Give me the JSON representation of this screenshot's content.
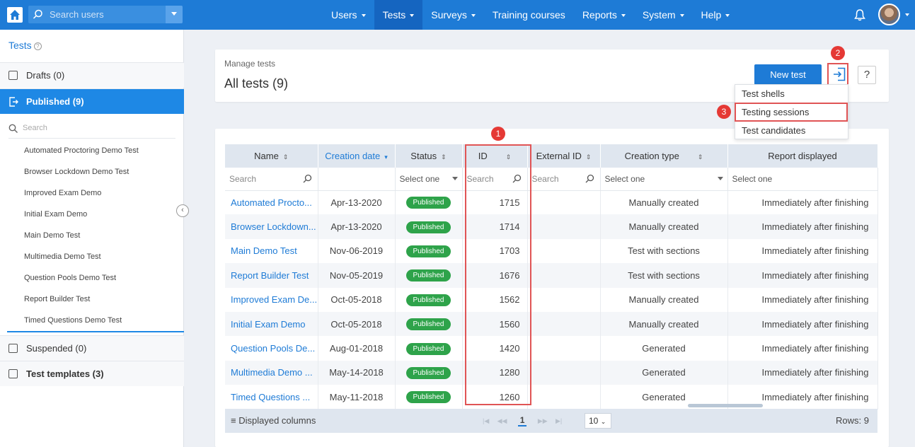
{
  "topbar": {
    "search_placeholder": "Search users",
    "nav": [
      {
        "label": "Users",
        "has_caret": true
      },
      {
        "label": "Tests",
        "has_caret": true,
        "active": true
      },
      {
        "label": "Surveys",
        "has_caret": true
      },
      {
        "label": "Training courses",
        "has_caret": false
      },
      {
        "label": "Reports",
        "has_caret": true
      },
      {
        "label": "System",
        "has_caret": true
      },
      {
        "label": "Help",
        "has_caret": true
      }
    ],
    "icons": [
      "home-icon",
      "search-icon",
      "bell-icon",
      "avatar"
    ]
  },
  "sidebar": {
    "title": "Tests",
    "sections": {
      "drafts": "Drafts (0)",
      "published": "Published (9)",
      "suspended": "Suspended (0)",
      "templates": "Test templates (3)"
    },
    "search_placeholder": "Search",
    "items": [
      "Automated Proctoring Demo Test",
      "Browser Lockdown Demo Test",
      "Improved Exam Demo",
      "Initial Exam Demo",
      "Main Demo Test",
      "Multimedia Demo Test",
      "Question Pools Demo Test",
      "Report Builder Test",
      "Timed Questions Demo Test"
    ]
  },
  "header": {
    "breadcrumb": "Manage tests",
    "title": "All tests (9)",
    "new_button": "New test",
    "help_button": "?"
  },
  "dropdown": {
    "items": [
      "Test shells",
      "Testing sessions",
      "Test candidates"
    ]
  },
  "markers": [
    "1",
    "2",
    "3"
  ],
  "table": {
    "columns": [
      "Name",
      "Creation date",
      "Status",
      "ID",
      "External ID",
      "Creation type",
      "Report displayed"
    ],
    "filters": {
      "name": "Search",
      "status": "Select one",
      "id": "Search",
      "external_id": "Search",
      "creation_type": "Select one",
      "report": "Select one"
    },
    "rows": [
      {
        "name": "Automated Procto...",
        "date": "Apr-13-2020",
        "status": "Published",
        "id": "1715",
        "ext": "",
        "ctype": "Manually created",
        "report": "Immediately after finishing"
      },
      {
        "name": "Browser Lockdown...",
        "date": "Apr-13-2020",
        "status": "Published",
        "id": "1714",
        "ext": "",
        "ctype": "Manually created",
        "report": "Immediately after finishing"
      },
      {
        "name": "Main Demo Test",
        "date": "Nov-06-2019",
        "status": "Published",
        "id": "1703",
        "ext": "",
        "ctype": "Test with sections",
        "report": "Immediately after finishing"
      },
      {
        "name": "Report Builder Test",
        "date": "Nov-05-2019",
        "status": "Published",
        "id": "1676",
        "ext": "",
        "ctype": "Test with sections",
        "report": "Immediately after finishing"
      },
      {
        "name": "Improved Exam De...",
        "date": "Oct-05-2018",
        "status": "Published",
        "id": "1562",
        "ext": "",
        "ctype": "Manually created",
        "report": "Immediately after finishing"
      },
      {
        "name": "Initial Exam Demo",
        "date": "Oct-05-2018",
        "status": "Published",
        "id": "1560",
        "ext": "",
        "ctype": "Manually created",
        "report": "Immediately after finishing"
      },
      {
        "name": "Question Pools De...",
        "date": "Aug-01-2018",
        "status": "Published",
        "id": "1420",
        "ext": "",
        "ctype": "Generated",
        "report": "Immediately after finishing"
      },
      {
        "name": "Multimedia Demo ...",
        "date": "May-14-2018",
        "status": "Published",
        "id": "1280",
        "ext": "",
        "ctype": "Generated",
        "report": "Immediately after finishing"
      },
      {
        "name": "Timed Questions ...",
        "date": "May-11-2018",
        "status": "Published",
        "id": "1260",
        "ext": "",
        "ctype": "Generated",
        "report": "Immediately after finishing"
      }
    ],
    "footer": {
      "columns_button": "Displayed columns",
      "current_page": "1",
      "rows_per_page": "10",
      "rows_count": "Rows: 9"
    }
  },
  "colors": {
    "primary": "#1e7bd6",
    "active_sidebar": "#1e88e5",
    "badge_green": "#2ea34a",
    "highlight_red": "#e53935"
  }
}
